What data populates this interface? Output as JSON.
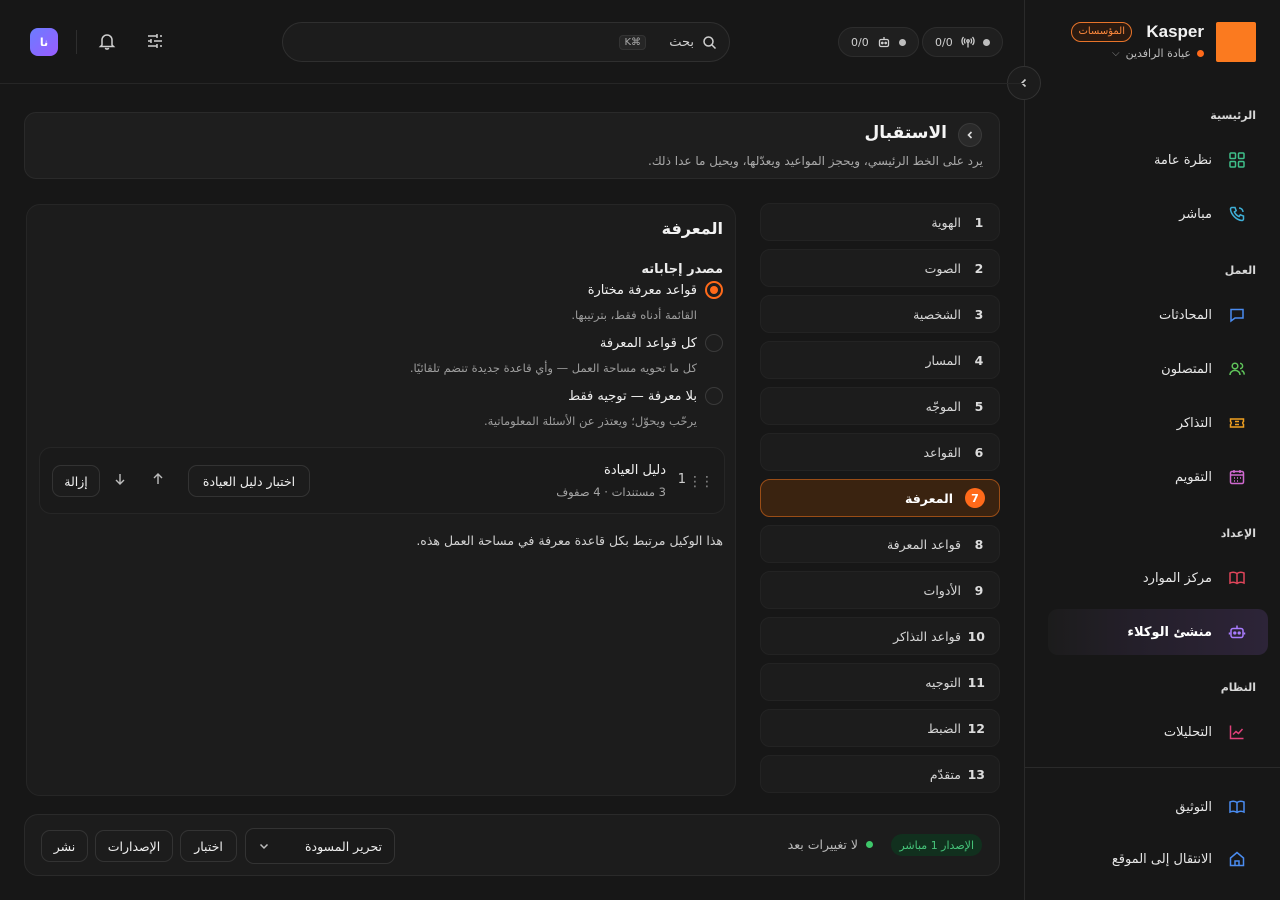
{
  "brand": {
    "name": "Kasper",
    "badge": "المؤسسات",
    "workspace": "عيادة الرافدين"
  },
  "sidebar": {
    "sections": [
      {
        "label": "الرئيسية"
      },
      {
        "label": "العمل"
      },
      {
        "label": "الإعداد"
      },
      {
        "label": "النظام"
      }
    ],
    "items": [
      {
        "label": "نظرة عامة",
        "icon": "grid-icon"
      },
      {
        "label": "مباشر",
        "icon": "phone-icon"
      },
      {
        "label": "المحادثات",
        "icon": "chat-icon"
      },
      {
        "label": "المتصلون",
        "icon": "users-icon"
      },
      {
        "label": "التذاكر",
        "icon": "ticket-icon"
      },
      {
        "label": "التقويم",
        "icon": "calendar-icon"
      },
      {
        "label": "مركز الموارد",
        "icon": "book-icon"
      },
      {
        "label": "منشئ الوكلاء",
        "icon": "robot-icon"
      },
      {
        "label": "التحليلات",
        "icon": "chart-icon"
      },
      {
        "label": "التوثيق",
        "icon": "docs-icon"
      },
      {
        "label": "الانتقال إلى الموقع",
        "icon": "home-icon"
      }
    ]
  },
  "topbar": {
    "calls_counter": "0/0",
    "agents_counter": "0/0",
    "search_placeholder": "بحث",
    "search_shortcut": "⌘K",
    "avatar_initials": "نا"
  },
  "header": {
    "title": "الاستقبال",
    "subtitle": "يرد على الخط الرئيسي، ويحجز المواعيد ويعدّلها، ويحيل ما عدا ذلك."
  },
  "steps": [
    {
      "num": "1",
      "label": "الهوية"
    },
    {
      "num": "2",
      "label": "الصوت"
    },
    {
      "num": "3",
      "label": "الشخصية"
    },
    {
      "num": "4",
      "label": "المسار"
    },
    {
      "num": "5",
      "label": "الموجّه"
    },
    {
      "num": "6",
      "label": "القواعد"
    },
    {
      "num": "7",
      "label": "المعرفة"
    },
    {
      "num": "8",
      "label": "قواعد المعرفة"
    },
    {
      "num": "9",
      "label": "الأدوات"
    },
    {
      "num": "10",
      "label": "قواعد التذاكر"
    },
    {
      "num": "11",
      "label": "التوجيه"
    },
    {
      "num": "12",
      "label": "الضبط"
    },
    {
      "num": "13",
      "label": "متقدّم"
    }
  ],
  "knowledge": {
    "title": "المعرفة",
    "source_label": "مصدر إجاباته",
    "options": [
      {
        "label": "قواعد معرفة مختارة",
        "desc": "القائمة أدناه فقط، بترتيبها.",
        "selected": true
      },
      {
        "label": "كل قواعد المعرفة",
        "desc": "كل ما تحويه مساحة العمل — وأي قاعدة جديدة تنضم تلقائيًا.",
        "selected": false
      },
      {
        "label": "بلا معرفة — توجيه فقط",
        "desc": "يرحّب ويحوّل؛ ويعتذر عن الأسئلة المعلوماتية.",
        "selected": false
      }
    ],
    "kb": {
      "index": "1",
      "name": "دليل العيادة",
      "meta": "3 مستندات · 4 صفوف",
      "test_label": "اختبار دليل العيادة",
      "remove_label": "إزالة"
    },
    "linked_note": "هذا الوكيل مرتبط بكل قاعدة معرفة في مساحة العمل هذه."
  },
  "bottom": {
    "live_badge": "الإصدار 1 مباشر",
    "status": "لا تغييرات بعد",
    "draft_select": "تحرير المسودة",
    "test_label": "اختبار",
    "versions_label": "الإصدارات",
    "publish_label": "نشر"
  },
  "colors": {
    "accent": "#ff6a1a",
    "brand_logo": "#fb7a1f",
    "live_green": "#3ec76a"
  }
}
